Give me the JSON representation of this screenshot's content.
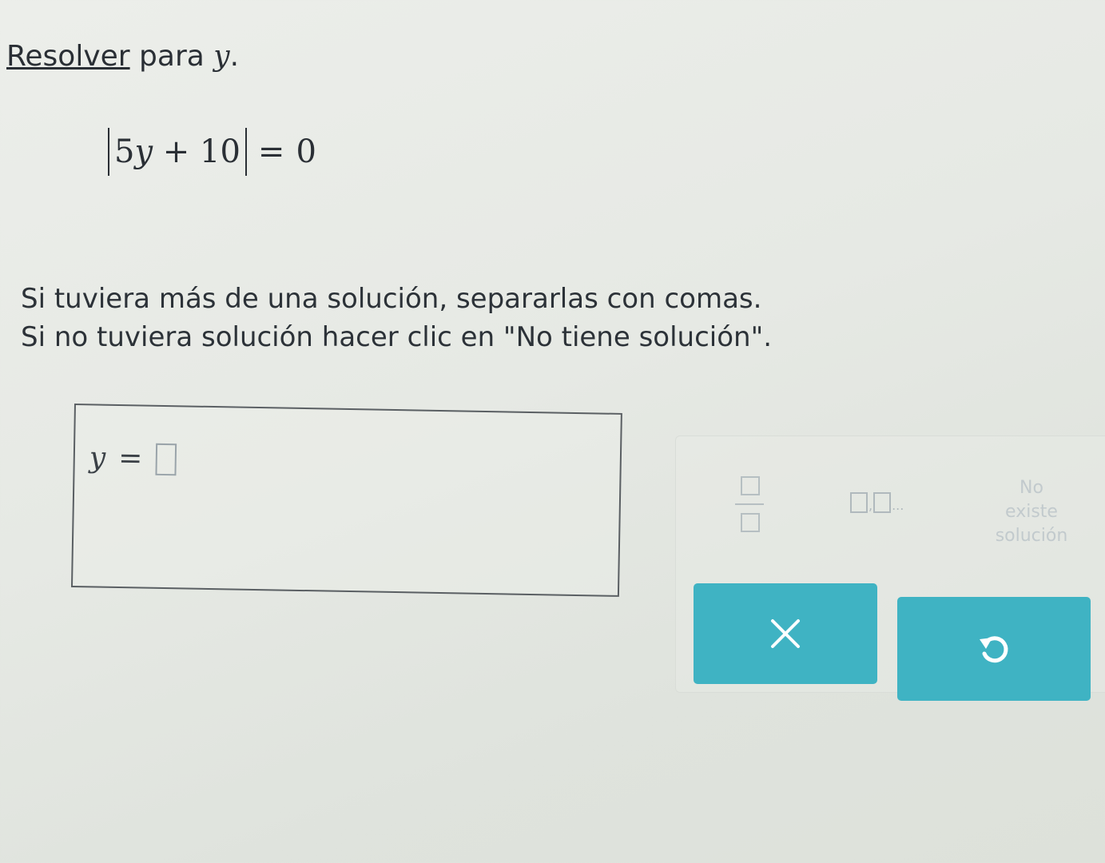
{
  "prompt": {
    "link_text": "Resolver",
    "text_middle": " para ",
    "variable": "y",
    "text_end": "."
  },
  "equation": {
    "coefficient": "5",
    "variable": "y",
    "operator": "+",
    "constant": "10",
    "equals": "=",
    "rhs": "0"
  },
  "instructions": {
    "line1": "Si tuviera más de una solución, separarlas con comas.",
    "line2": "Si no tuviera solución hacer clic en \"No tiene solución\"."
  },
  "answer": {
    "variable": "y",
    "equals": "=",
    "value": ""
  },
  "keypad": {
    "fraction_key": "fraction-template",
    "list_key_separator": ",",
    "list_key_ellipsis": "...",
    "no_solution_line1": "No",
    "no_solution_line2": "existe",
    "no_solution_line3": "solución"
  },
  "buttons": {
    "clear_symbol": "✕",
    "undo_symbol": "↺"
  },
  "colors": {
    "button_teal": "#3fb3c3",
    "text_dark": "#2a2f35",
    "key_muted": "#b6bfc2"
  },
  "icons": {
    "clear": "close-icon",
    "undo": "undo-icon"
  }
}
